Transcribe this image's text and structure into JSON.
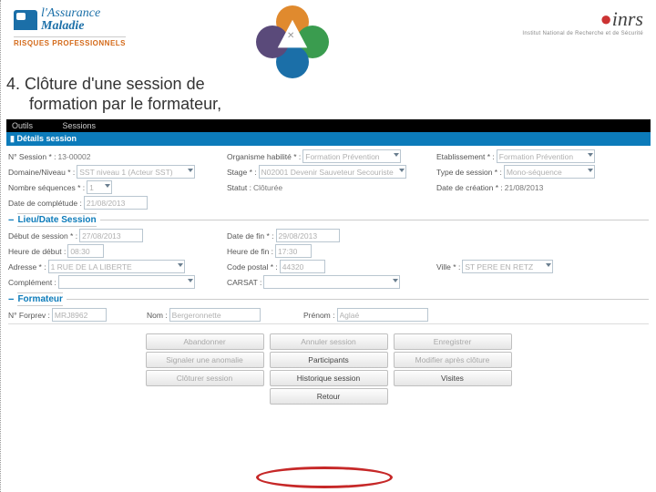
{
  "header": {
    "brand_top": "l'Assurance",
    "brand_bottom": "Maladie",
    "brand_sub": "RISQUES PROFESSIONNELS",
    "right_brand": "inrs",
    "right_sub": "Institut National de Recherche et de Sécurité"
  },
  "slide": {
    "number": "4.",
    "title_l1": "Clôture d'une session de",
    "title_l2": "formation par le formateur,"
  },
  "menubar": {
    "item1": "Outils",
    "item2": "Sessions"
  },
  "panel": {
    "details_title": "▮ Détails session"
  },
  "details": {
    "num_label": "N° Session *  :",
    "num_value": "13-00002",
    "org_label": "Organisme habilité *  :",
    "org_value": "Formation Prévention",
    "etab_label": "Etablissement *  :",
    "etab_value": "Formation Prévention",
    "domaine_label": "Domaine/Niveau *  :",
    "domaine_value": "SST niveau 1 (Acteur SST)",
    "stage_label": "Stage *  :",
    "stage_value": "N02001 Devenir Sauveteur Secouriste",
    "type_label": "Type de session *  :",
    "type_value": "Mono-séquence",
    "nbseq_label": "Nombre séquences *  :",
    "nbseq_value": "1",
    "statut_label": "Statut  :",
    "statut_value": "Clôturée",
    "datecrea_label": "Date de création *  :",
    "datecrea_value": "21/08/2013",
    "datecomp_label": "Date de complétude  :",
    "datecomp_value": "21/08/2013"
  },
  "sections": {
    "lieu_title": "Lieu/Date Session",
    "formateur_title": "Formateur"
  },
  "lieu": {
    "debut_label": "Début de session *  :",
    "debut_value": "27/08/2013",
    "fin_label": "Date de fin *  :",
    "fin_value": "29/08/2013",
    "hdeb_label": "Heure de début  :",
    "hdeb_value": "08:30",
    "hfin_label": "Heure de fin  :",
    "hfin_value": "17:30",
    "adr_label": "Adresse *  :",
    "adr_value": "1 RUE DE LA LIBERTE",
    "cp_label": "Code postal *  :",
    "cp_value": "44320",
    "ville_label": "Ville *  :",
    "ville_value": "ST PERE EN RETZ",
    "compl_label": "Complément  :",
    "carsat_label": "CARSAT  :"
  },
  "formateur": {
    "num_label": "N° Forprev  :",
    "num_value": "MRJ8962",
    "nom_label": "Nom  :",
    "nom_value": "Bergeronnette",
    "prenom_label": "Prénom  :",
    "prenom_value": "Aglaé"
  },
  "buttons": {
    "r1c1": "Abandonner",
    "r1c2": "Annuler session",
    "r1c3": "Enregistrer",
    "r2c1": "Signaler une anomalie",
    "r2c2": "Participants",
    "r2c3": "Modifier après clôture",
    "r3c1": "Clôturer session",
    "r3c2": "Historique session",
    "r3c3": "Visites",
    "r4": "Retour"
  }
}
